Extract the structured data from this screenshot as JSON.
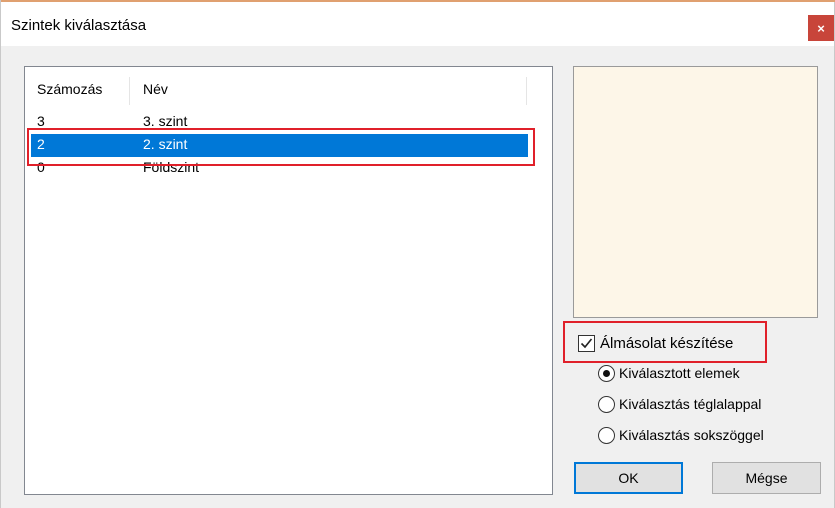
{
  "window": {
    "title": "Szintek kiválasztása",
    "close_glyph": "×"
  },
  "list": {
    "columns": [
      "Számozás",
      "Név"
    ],
    "rows": [
      {
        "number": "3",
        "name": "3. szint",
        "selected": false
      },
      {
        "number": "2",
        "name": "2. szint",
        "selected": true
      },
      {
        "number": "0",
        "name": "Földszint",
        "selected": false
      }
    ]
  },
  "options": {
    "copy_checkbox": {
      "label": "Álmásolat készítése",
      "checked": true
    },
    "radios": [
      {
        "label": "Kiválasztott elemek",
        "selected": true
      },
      {
        "label": "Kiválasztás téglalappal",
        "selected": false
      },
      {
        "label": "Kiválasztás sokszöggel",
        "selected": false
      }
    ]
  },
  "buttons": {
    "ok": "OK",
    "cancel": "Mégse"
  },
  "colors": {
    "selection": "#0078d7",
    "highlight_annotation": "#e0202a",
    "preview_background": "#fdf6e8",
    "close_button": "#c8453a"
  }
}
